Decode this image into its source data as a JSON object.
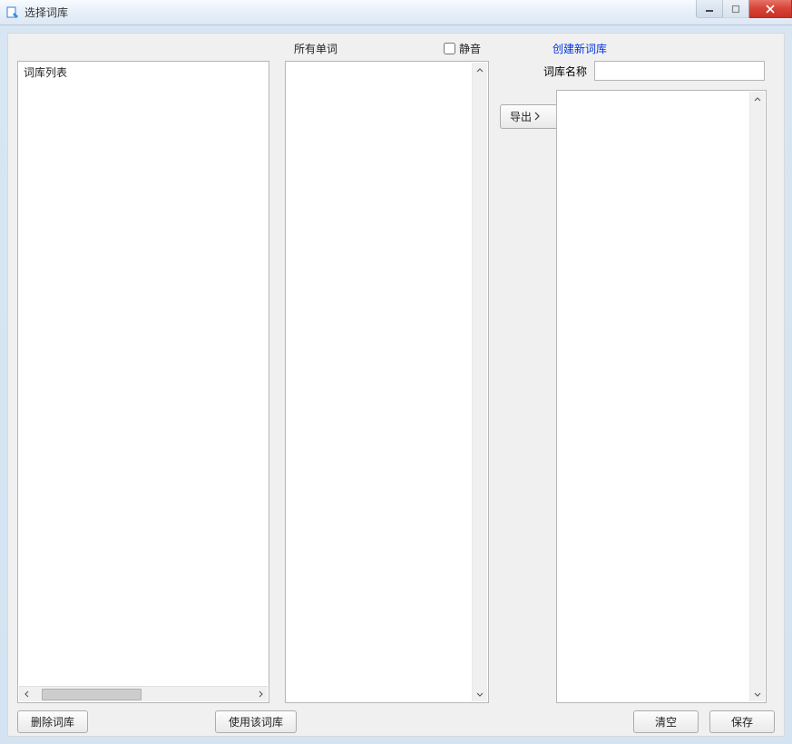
{
  "window": {
    "title": "选择词库"
  },
  "labels": {
    "all_words": "所有单词",
    "mute": "静音",
    "create_new": "创建新词库",
    "wordbank_name": "词库名称",
    "wordbank_list_header": "词库列表"
  },
  "buttons": {
    "delete_wordbank": "删除词库",
    "use_wordbank": "使用该词库",
    "export": "导出",
    "clear": "清空",
    "save": "保存"
  },
  "inputs": {
    "mute_checked": false,
    "wordbank_name_value": ""
  }
}
